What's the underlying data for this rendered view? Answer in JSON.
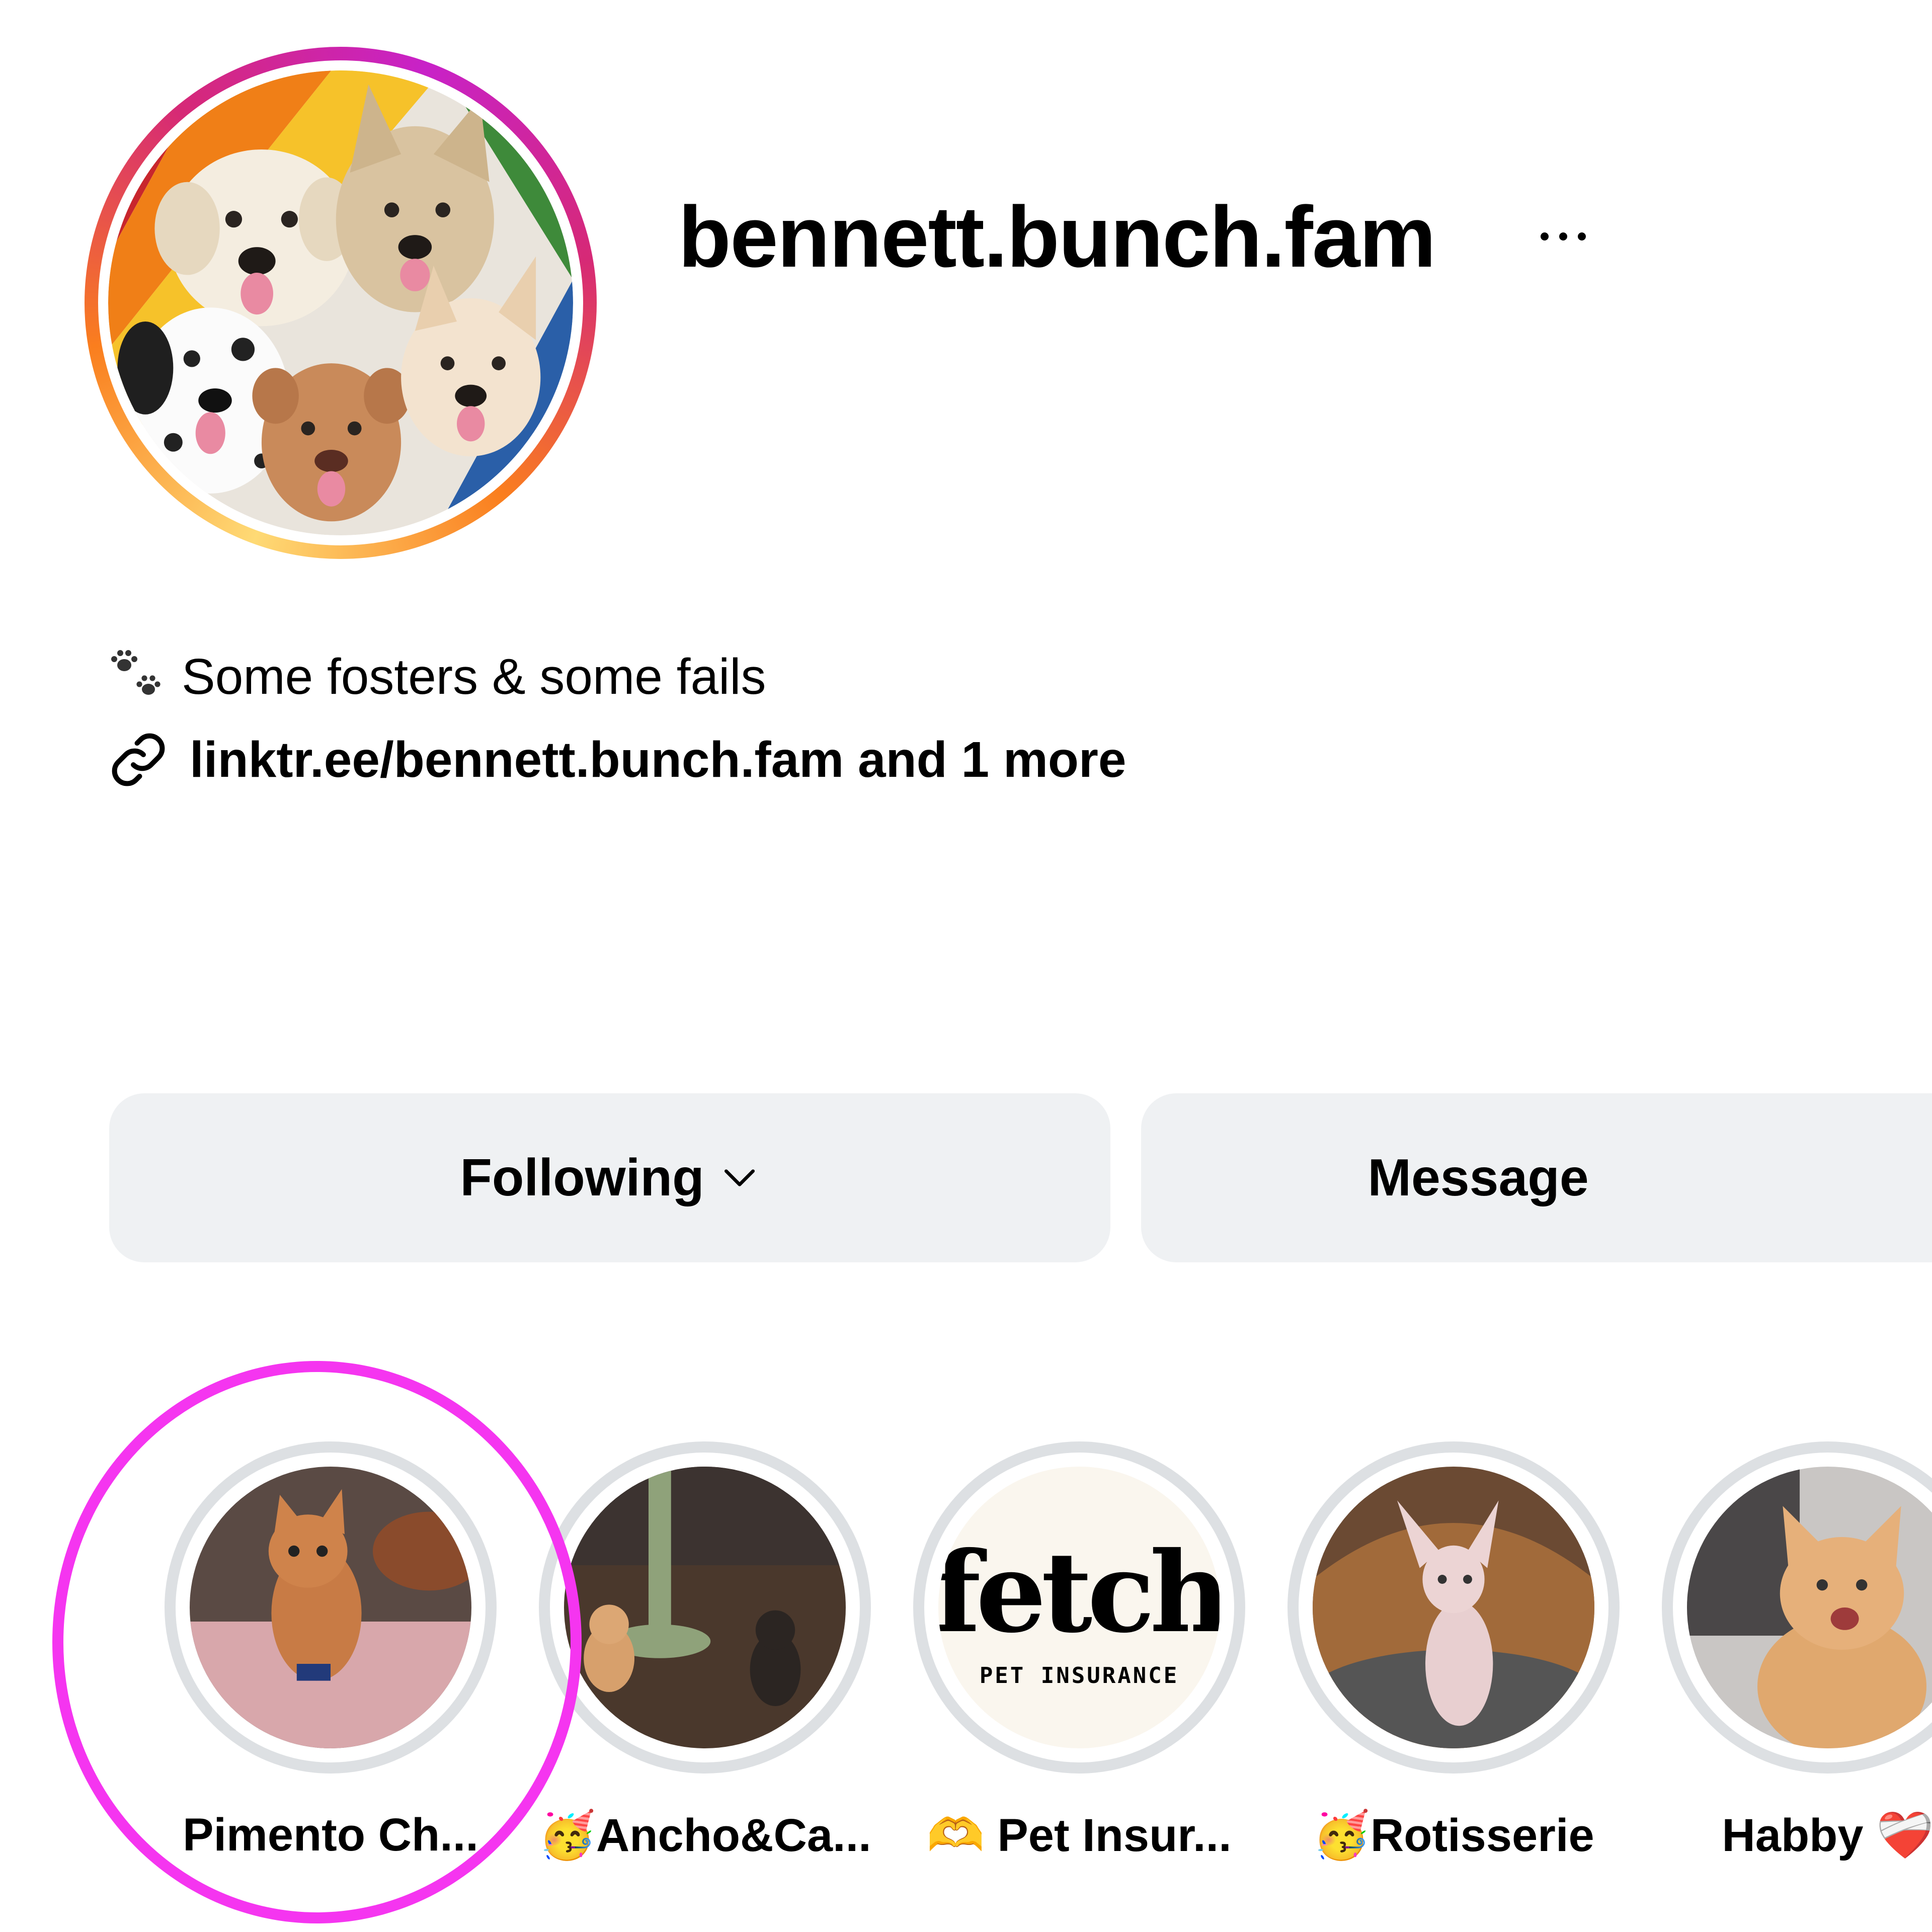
{
  "profile": {
    "username": "bennett.bunch.fam",
    "more_options_icon": "ellipsis-icon",
    "avatar_icon": "profile-avatar-dogs-illustration",
    "story_ring_colors": [
      "#feda75",
      "#fa7e1e",
      "#d62976",
      "#c822c8"
    ]
  },
  "bio": {
    "text": "Some fosters & some fails",
    "icon": "paw-prints-icon"
  },
  "link": {
    "text": "linktr.ee/bennett.bunch.fam and 1 more",
    "icon": "link-icon"
  },
  "actions": {
    "following_label": "Following",
    "following_icon": "chevron-down-icon",
    "message_label": "Message",
    "button_bg": "#eff1f3"
  },
  "highlights": [
    {
      "label": "Pimento Ch...",
      "prefix": ""
    },
    {
      "label": "Ancho&Ca...",
      "prefix": "🥳"
    },
    {
      "label": "Pet Insur...",
      "prefix": "🫶"
    },
    {
      "label": "Rotisserie",
      "prefix": "🥳"
    },
    {
      "label": "Habby",
      "suffix": "❤️‍🩹"
    }
  ],
  "fetch_cover": {
    "brand": "fetch",
    "tagline": "PET INSURANCE"
  },
  "annotation": {
    "color": "#f535f0"
  }
}
